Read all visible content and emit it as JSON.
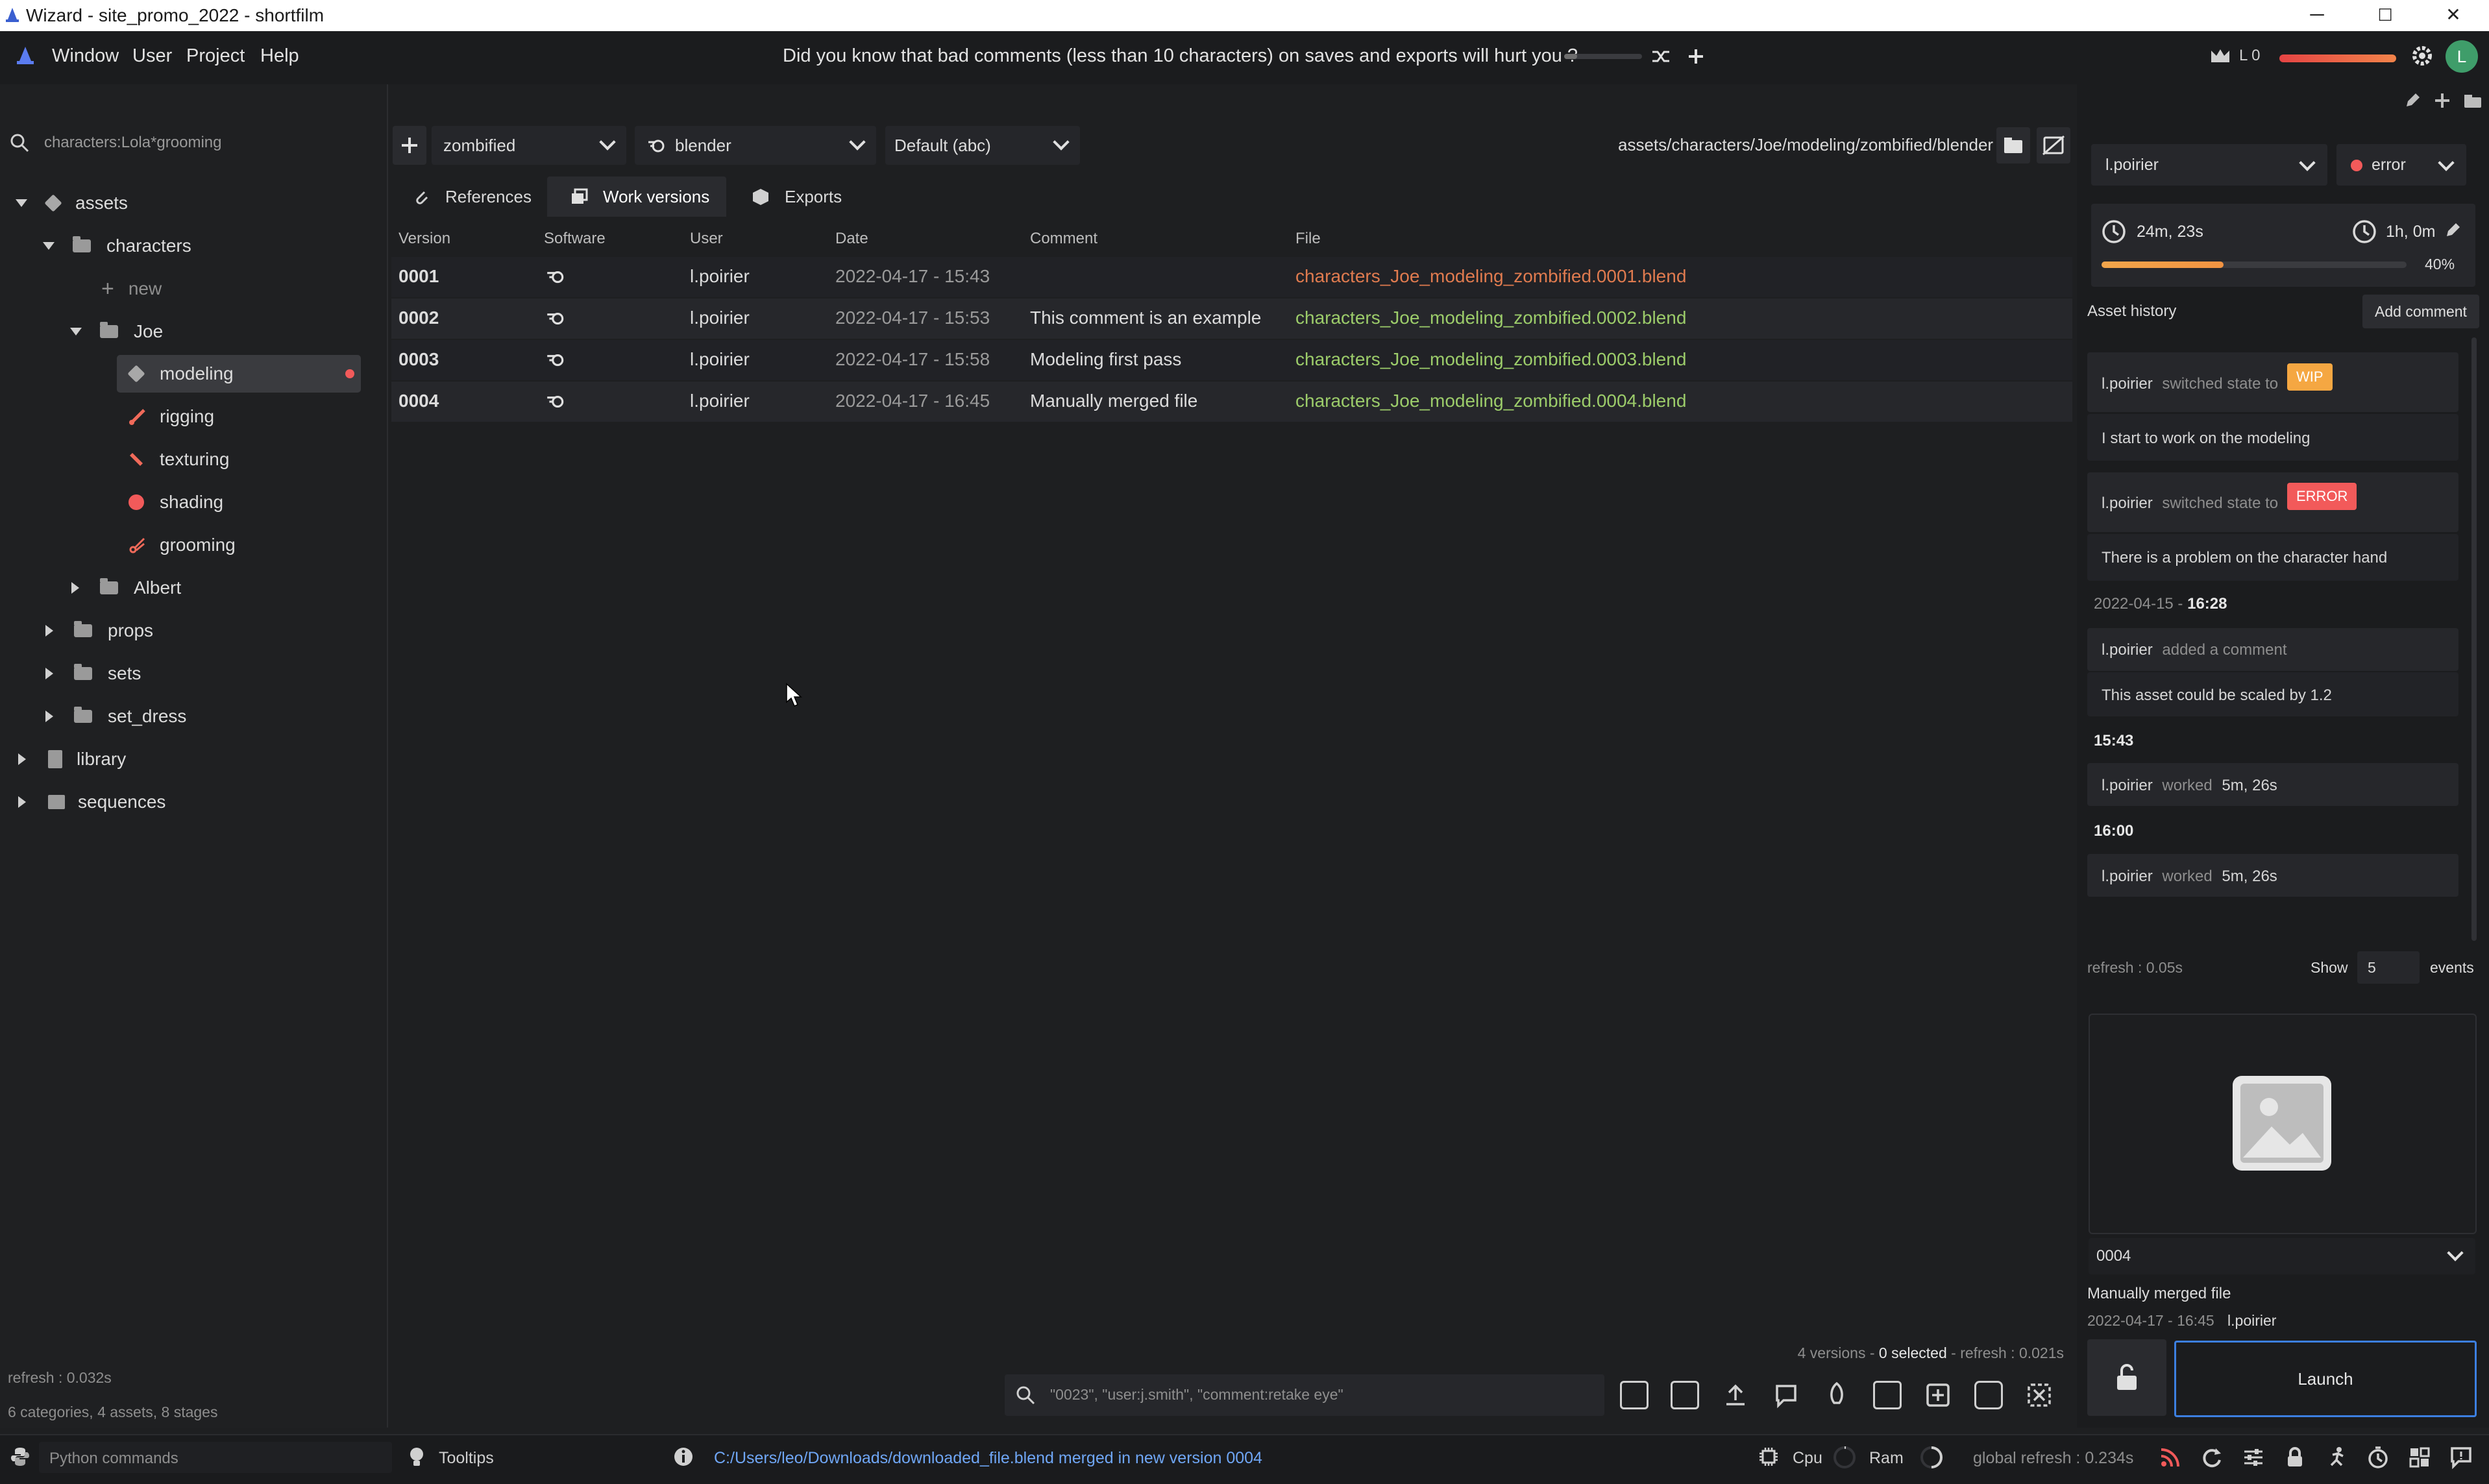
{
  "window": {
    "title": "Wizard - site_promo_2022 - shortfilm",
    "controls": {
      "minimize": "─",
      "maximize": "☐",
      "close": "✕"
    }
  },
  "menubar": {
    "items": [
      "Window",
      "User",
      "Project",
      "Help"
    ],
    "tip": "Did you know that bad comments (less than 10 characters) on saves and exports will hurt you ?",
    "user_level": "L 0",
    "avatar_letter": "L"
  },
  "left": {
    "search_value": "characters:Lola*grooming",
    "tree": {
      "assets": "assets",
      "characters": "characters",
      "new": "new",
      "joe": "Joe",
      "modeling": "modeling",
      "rigging": "rigging",
      "texturing": "texturing",
      "shading": "shading",
      "grooming": "grooming",
      "albert": "Albert",
      "props": "props",
      "sets": "sets",
      "set_dress": "set_dress",
      "library": "library",
      "sequences": "sequences"
    },
    "refresh": "refresh : 0.032s",
    "stats": "6 categories, 4 assets, 8 stages"
  },
  "center": {
    "variant": "zombified",
    "software": "blender",
    "export_format": "Default (abc)",
    "path": "assets/characters/Joe/modeling/zombified/blender",
    "tabs": [
      "References",
      "Work versions",
      "Exports"
    ],
    "columns": [
      "Version",
      "Software",
      "User",
      "Date",
      "Comment",
      "File"
    ],
    "rows": [
      {
        "version": "0001",
        "user": "l.poirier",
        "date": "2022-04-17 - 15:43",
        "comment": "",
        "file": "characters_Joe_modeling_zombified.0001.blend",
        "file_color": "#e07b4f"
      },
      {
        "version": "0002",
        "user": "l.poirier",
        "date": "2022-04-17 - 15:53",
        "comment": "This comment is an example",
        "file": "characters_Joe_modeling_zombified.0002.blend",
        "file_color": "#9ccc6a"
      },
      {
        "version": "0003",
        "user": "l.poirier",
        "date": "2022-04-17 - 15:58",
        "comment": "Modeling first pass",
        "file": "characters_Joe_modeling_zombified.0003.blend",
        "file_color": "#9ccc6a"
      },
      {
        "version": "0004",
        "user": "l.poirier",
        "date": "2022-04-17 - 16:45",
        "comment": "Manually merged file",
        "file": "characters_Joe_modeling_zombified.0004.blend",
        "file_color": "#9ccc6a"
      }
    ],
    "status_versions": "4 versions - ",
    "status_selected": "0 selected",
    "status_refresh": " - refresh : 0.021s",
    "search_placeholder": "\"0023\", \"user:j.smith\", \"comment:retake eye\""
  },
  "right": {
    "assignee": "l.poirier",
    "state": "error",
    "time_spent": "24m, 23s",
    "estimated": "1h, 0m",
    "progress_percent": 40,
    "progress_label": "40%",
    "history_title": "Asset history",
    "add_comment": "Add comment",
    "events": {
      "e1_user": "l.poirier",
      "e1_action": "switched state to",
      "e1_badge": "WIP",
      "e1_comment": "I start to work on the modeling",
      "e2_user": "l.poirier",
      "e2_action": "switched state to",
      "e2_badge": "ERROR",
      "e2_comment": "There is a problem on the character hand",
      "day_date": "2022-04-15 - ",
      "day_time": "16:28",
      "e3_user": "l.poirier",
      "e3_action": "added a comment",
      "e3_comment": "This asset could be scaled by 1.2",
      "t1": "15:43",
      "e4_user": "l.poirier",
      "e4_action": "worked",
      "e4_value": "5m, 26s",
      "t2": "16:00",
      "e5_user": "l.poirier",
      "e5_action": "worked",
      "e5_value": "5m, 26s"
    },
    "refresh": "refresh : 0.05s",
    "show_label": "Show",
    "show_count": "5",
    "events_label": "events",
    "version_select": "0004",
    "version_comment": "Manually merged file",
    "version_date": "2022-04-17 - 16:45",
    "version_user": "l.poirier",
    "launch": "Launch",
    "colors": {
      "wip": "#f5a742",
      "error": "#f25a5a",
      "accent": "#3c7fe0"
    }
  },
  "bottom": {
    "python_placeholder": "Python commands",
    "tooltips": "Tooltips",
    "message": "C:/Users/leo/Downloads/downloaded_file.blend merged in new version 0004",
    "cpu": "Cpu",
    "ram": "Ram",
    "global_refresh": "global refresh : 0.234s"
  }
}
